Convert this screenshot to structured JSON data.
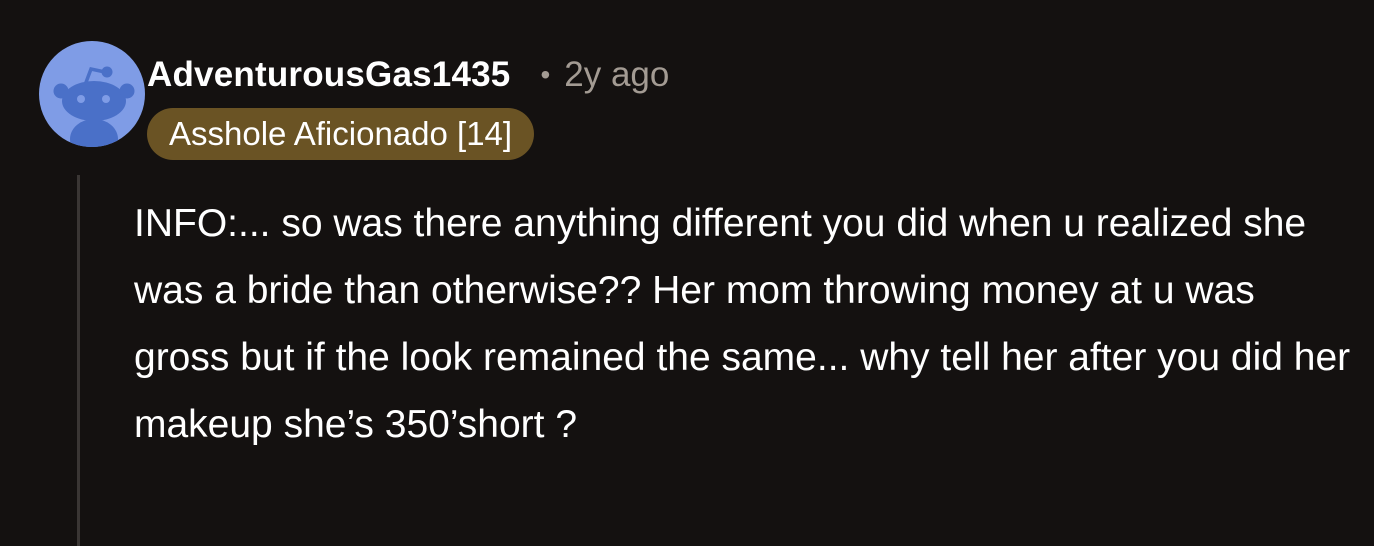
{
  "comment": {
    "author": "AdventurousGas1435",
    "separator": "•",
    "time_ago": "2y ago",
    "flair": "Asshole Aficionado [14]",
    "body": "INFO:... so was there anything different you did when u realized she was a bride than otherwise?? Her mom throwing money at u was gross but if the look remained the same... why tell her after you did her makeup she’s 350’short ?"
  },
  "avatar": {
    "icon": "snoo-avatar-icon",
    "background_color": "#7f9ce6",
    "figure_color": "#4a70c8"
  },
  "colors": {
    "background": "#141110",
    "text": "#ffffff",
    "meta_text": "#a39b93",
    "flair_background": "#6a5324",
    "thread_line": "#3a3634"
  }
}
